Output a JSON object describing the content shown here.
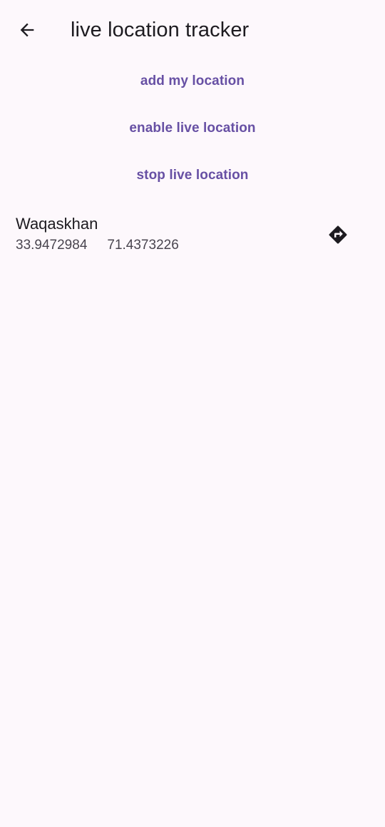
{
  "app_bar": {
    "title": "live location tracker",
    "back_icon": "arrow-back-icon"
  },
  "actions": {
    "add_location": "add my location",
    "enable_live": "enable live location",
    "stop_live": "stop live location",
    "accent_color": "#6750a4"
  },
  "locations": [
    {
      "name": "Waqaskhan",
      "latitude": "33.9472984",
      "longitude": "71.4373226",
      "action_icon": "directions-icon"
    }
  ]
}
